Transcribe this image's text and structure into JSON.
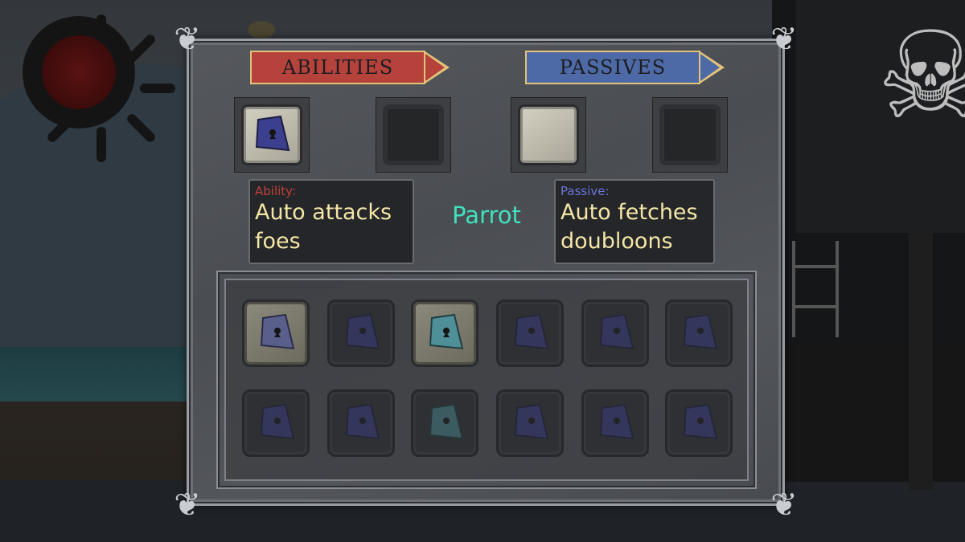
{
  "banners": {
    "abilities": "ABILITIES",
    "passives": "PASSIVES"
  },
  "equipped": {
    "ability_slot_1": {
      "filled": true,
      "item": "blue-flag-icon"
    },
    "ability_slot_2": {
      "filled": false
    },
    "passive_slot_1": {
      "filled": true,
      "item": "blank"
    },
    "passive_slot_2": {
      "filled": false
    }
  },
  "pet": {
    "name": "Parrot",
    "ability_label": "Ability:",
    "ability_text": "Auto attacks foes",
    "passive_label": "Passive:",
    "passive_text": "Auto fetches doubloons"
  },
  "inventory": {
    "row1": [
      {
        "item": "blue-flag-icon",
        "state": "lit"
      },
      {
        "item": "blue-flag-icon",
        "state": "dim"
      },
      {
        "item": "teal-flag-icon",
        "state": "lit"
      },
      {
        "item": "blue-flag-icon",
        "state": "dim"
      },
      {
        "item": "blue-flag-icon",
        "state": "dim"
      },
      {
        "item": "blue-flag-icon",
        "state": "dim"
      }
    ],
    "row2": [
      {
        "item": "blue-flag-icon",
        "state": "dim"
      },
      {
        "item": "blue-flag-icon",
        "state": "dim"
      },
      {
        "item": "teal-flag-icon",
        "state": "dim"
      },
      {
        "item": "blue-flag-icon",
        "state": "dim"
      },
      {
        "item": "blue-flag-icon",
        "state": "dim"
      },
      {
        "item": "blue-flag-icon",
        "state": "dim"
      }
    ]
  },
  "colors": {
    "ability_banner": "#b5423b",
    "passive_banner": "#4d6aa6",
    "ability_label": "#c0413a",
    "passive_label": "#6a74d8",
    "pet_name": "#40e0c0",
    "info_text": "#f4e6a6",
    "blue_flag": "#3c3f8e",
    "teal_flag": "#4f8f97"
  }
}
